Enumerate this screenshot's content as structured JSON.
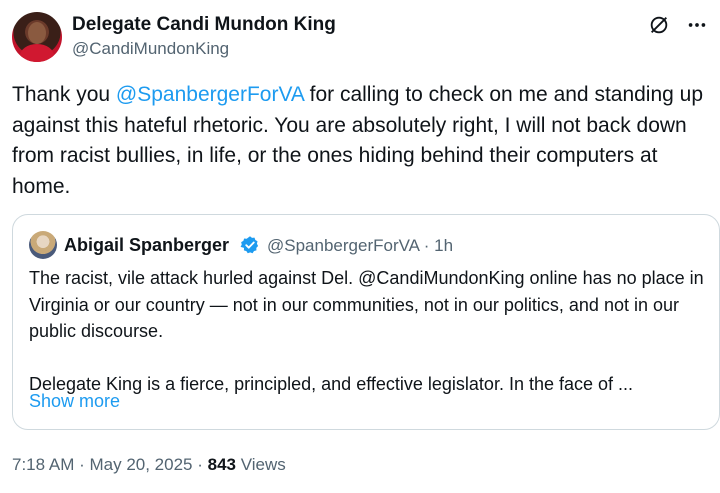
{
  "author": {
    "display_name": "Delegate Candi Mundon King",
    "handle": "@CandiMundonKing"
  },
  "tweet": {
    "text_before": "Thank you ",
    "mention": "@SpanbergerForVA",
    "text_after": " for calling to check on me and standing up against this hateful rhetoric. You are absolutely right, I will not back down from racist bullies, in life, or the ones hiding behind their computers at home."
  },
  "quote": {
    "display_name": "Abigail Spanberger",
    "handle_time": "@SpanbergerForVA · 1h",
    "para1": "The racist, vile attack hurled against Del. @CandiMundonKing online has no place in Virginia or our country — not in our communities, not in our politics, and not in our public discourse.",
    "para2": "Delegate King is a fierce, principled, and effective legislator. In the face of ...",
    "show_more": "Show more"
  },
  "meta": {
    "timestamp": "7:18 AM · May 20, 2025 · ",
    "views_count": "843",
    "views_label": " Views"
  },
  "icons": {
    "header_actions": [
      "grok-icon",
      "more-icon"
    ],
    "verified": "verified-badge-icon"
  },
  "colors": {
    "accent": "#1d9bf0",
    "text": "#0f1419",
    "secondary": "#536471",
    "border": "#cfd9de"
  }
}
